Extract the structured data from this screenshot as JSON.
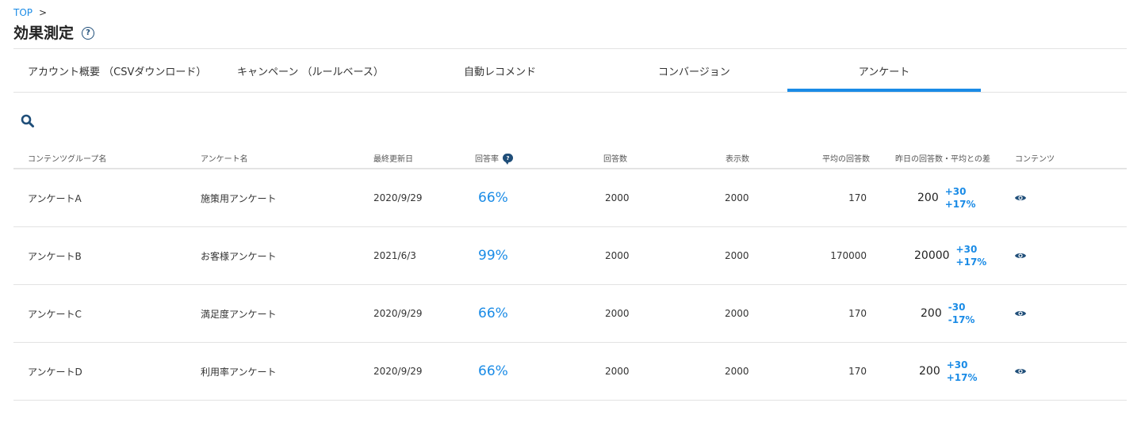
{
  "breadcrumb": {
    "top_label": "TOP",
    "separator": ">"
  },
  "page": {
    "title": "効果測定",
    "help_icon": "help-circle-icon"
  },
  "tabs": [
    {
      "label": "アカウント概要 （CSVダウンロード）",
      "active": false
    },
    {
      "label": "キャンペーン （ルールベース）",
      "active": false
    },
    {
      "label": "自動レコメンド",
      "active": false
    },
    {
      "label": "コンバージョン",
      "active": false
    },
    {
      "label": "アンケート",
      "active": true
    }
  ],
  "search": {
    "icon": "search-icon"
  },
  "table": {
    "headers": {
      "group": "コンテンツグループ名",
      "survey": "アンケート名",
      "updated": "最終更新日",
      "rate": "回答率",
      "answers": "回答数",
      "views": "表示数",
      "avg": "平均の回答数",
      "yesterday": "昨日の回答数・平均との差",
      "contents": "コンテンツ"
    },
    "rows": [
      {
        "group": "アンケートA",
        "survey": "施策用アンケート",
        "updated": "2020/9/29",
        "rate": "66%",
        "answers": "2000",
        "views": "2000",
        "avg": "170",
        "yesterday": "200",
        "diff1": "+30",
        "diff2": "+17%"
      },
      {
        "group": "アンケートB",
        "survey": "お客様アンケート",
        "updated": "2021/6/3",
        "rate": "99%",
        "answers": "2000",
        "views": "2000",
        "avg": "170000",
        "yesterday": "20000",
        "diff1": "+30",
        "diff2": "+17%"
      },
      {
        "group": "アンケートC",
        "survey": "満足度アンケート",
        "updated": "2020/9/29",
        "rate": "66%",
        "answers": "2000",
        "views": "2000",
        "avg": "170",
        "yesterday": "200",
        "diff1": "-30",
        "diff2": "-17%"
      },
      {
        "group": "アンケートD",
        "survey": "利用率アンケート",
        "updated": "2020/9/29",
        "rate": "66%",
        "answers": "2000",
        "views": "2000",
        "avg": "170",
        "yesterday": "200",
        "diff1": "+30",
        "diff2": "+17%"
      }
    ]
  },
  "colors": {
    "accent": "#1a8be6",
    "icon_dark": "#1f4e79",
    "divider": "#e3e3e3"
  }
}
